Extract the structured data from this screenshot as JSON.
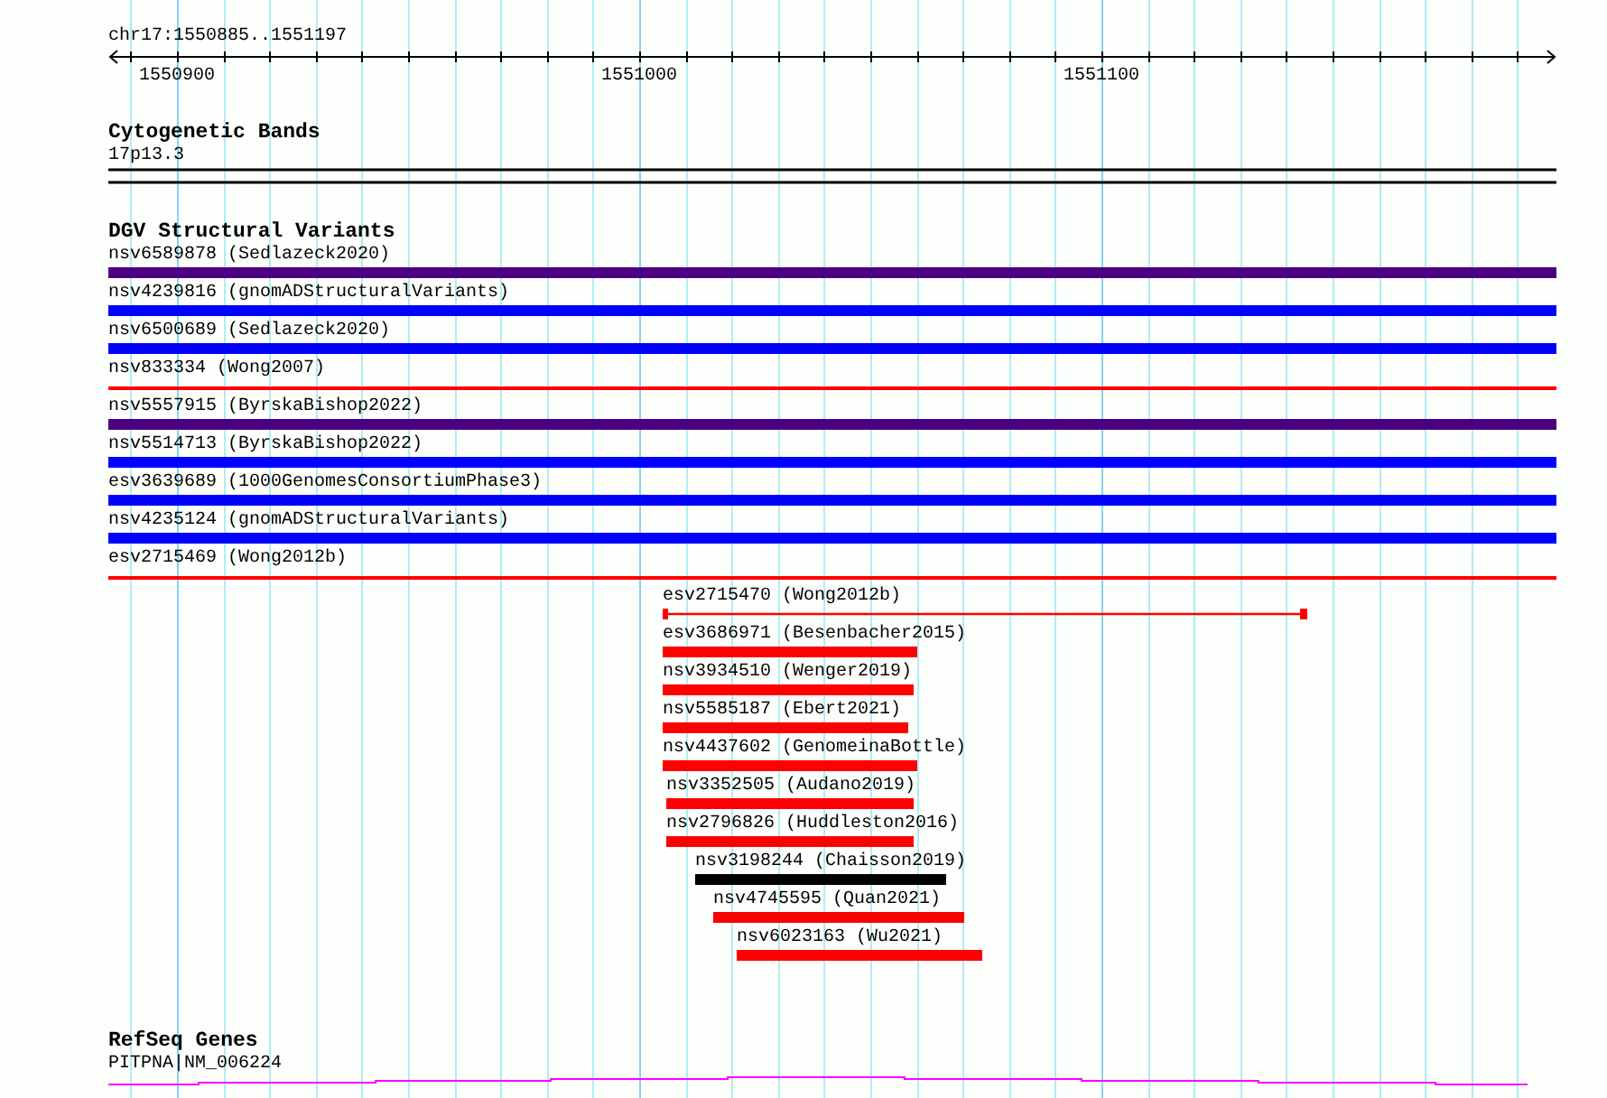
{
  "ruler": {
    "location": "chr17:1550885..1551197",
    "tick_labels": [
      "1550900",
      "1551000",
      "1551100"
    ]
  },
  "tracks": [
    {
      "kind": "bands",
      "title": "Cytogenetic Bands",
      "features": [
        {
          "label": "17p13.3"
        }
      ]
    },
    {
      "kind": "variants",
      "title": "DGV Structural Variants",
      "features": [
        {
          "label": "nsv6589878 (Sedlazeck2020)",
          "kind": "bar",
          "color": "#4b0082"
        },
        {
          "label": "nsv4239816 (gnomADStructuralVariants)",
          "kind": "bar",
          "color": "#0000ff"
        },
        {
          "label": "nsv6500689 (Sedlazeck2020)",
          "kind": "bar",
          "color": "#0000ff"
        },
        {
          "label": "nsv833334 (Wong2007)",
          "kind": "line",
          "color": "#ff0000"
        },
        {
          "label": "nsv5557915 (ByrskaBishop2022)",
          "kind": "bar",
          "color": "#4b0082"
        },
        {
          "label": "nsv5514713 (ByrskaBishop2022)",
          "kind": "bar",
          "color": "#0000ff"
        },
        {
          "label": "esv3639689 (1000GenomesConsortiumPhase3)",
          "kind": "bar",
          "color": "#0000ff"
        },
        {
          "label": "nsv4235124 (gnomADStructuralVariants)",
          "kind": "bar",
          "color": "#0000ff"
        },
        {
          "label": "esv2715469 (Wong2012b)",
          "kind": "line",
          "color": "#ff0000"
        },
        {
          "label": "esv2715470 (Wong2012b)",
          "kind": "capped",
          "color": "#ff0000"
        },
        {
          "label": "esv3686971 (Besenbacher2015)",
          "kind": "bar",
          "color": "#ff0000"
        },
        {
          "label": "nsv3934510 (Wenger2019)",
          "kind": "bar",
          "color": "#ff0000"
        },
        {
          "label": "nsv5585187 (Ebert2021)",
          "kind": "bar",
          "color": "#ff0000"
        },
        {
          "label": "nsv4437602 (GenomeinaBottle)",
          "kind": "bar",
          "color": "#ff0000"
        },
        {
          "label": "nsv3352505 (Audano2019)",
          "kind": "bar",
          "color": "#ff0000"
        },
        {
          "label": "nsv2796826 (Huddleston2016)",
          "kind": "bar",
          "color": "#ff0000"
        },
        {
          "label": "nsv3198244 (Chaisson2019)",
          "kind": "bar",
          "color": "#000000"
        },
        {
          "label": "nsv4745595 (Quan2021)",
          "kind": "bar",
          "color": "#ff0000"
        },
        {
          "label": "nsv6023163 (Wu2021)",
          "kind": "bar",
          "color": "#ff0000"
        }
      ]
    },
    {
      "kind": "genes",
      "title": "RefSeq Genes",
      "features": [
        {
          "label": "PITPNA|NM_006224"
        }
      ]
    }
  ]
}
